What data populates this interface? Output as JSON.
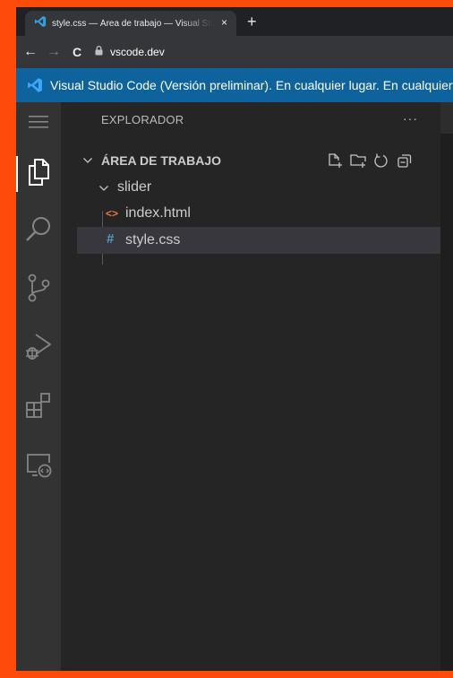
{
  "browser": {
    "tab": {
      "title": "style.css — Área de trabajo — Visual Studio Code",
      "close_glyph": "×",
      "new_tab_glyph": "+"
    },
    "nav": {
      "back": "←",
      "forward": "→",
      "reload": "C"
    },
    "url": "vscode.dev"
  },
  "infobar": {
    "text": "Visual Studio Code (Versión preliminar). En cualquier lugar. En cualquier momento."
  },
  "activity_bar": {
    "items": [
      {
        "icon": "menu-icon",
        "active": false
      },
      {
        "icon": "explorer-files-icon",
        "active": true
      },
      {
        "icon": "search-icon",
        "active": false
      },
      {
        "icon": "source-control-icon",
        "active": false
      },
      {
        "icon": "run-debug-icon",
        "active": false
      },
      {
        "icon": "extensions-icon",
        "active": false
      },
      {
        "icon": "remote-explorer-icon",
        "active": false
      }
    ]
  },
  "sidebar": {
    "title": "EXPLORADOR",
    "more_actions": "···",
    "section": {
      "title": "ÁREA DE TRABAJO",
      "actions": [
        "new-file-icon",
        "new-folder-icon",
        "refresh-icon",
        "collapse-all-icon"
      ]
    },
    "tree": [
      {
        "type": "folder",
        "label": "slider",
        "expanded": true,
        "selected": false
      },
      {
        "type": "file",
        "label": "index.html",
        "file_icon": "<>",
        "selected": false
      },
      {
        "type": "file",
        "label": "style.css",
        "file_icon": "#",
        "selected": true
      }
    ]
  },
  "colors": {
    "accent_orange": "#fc4b0b",
    "infobar_blue": "#0e639c",
    "activity_bar": "#333333",
    "sidebar": "#252526",
    "selected_row": "#37373d"
  }
}
